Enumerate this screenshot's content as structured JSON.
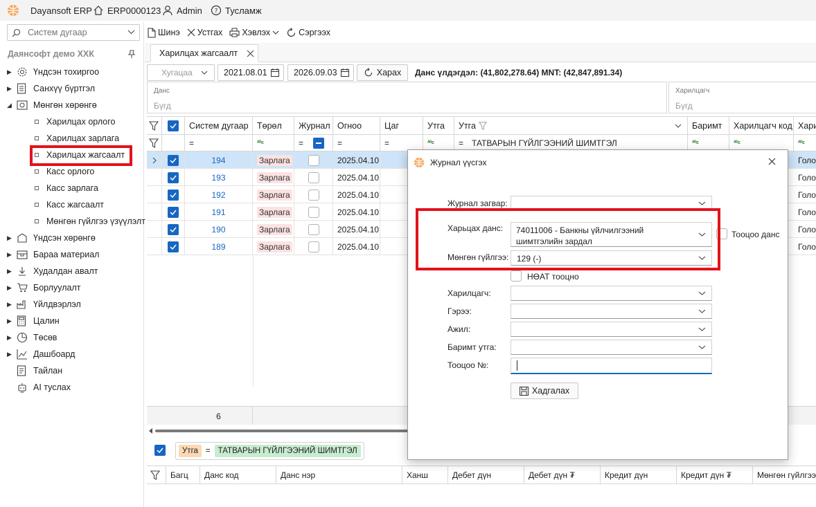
{
  "titlebar": {
    "app_name": "Dayansoft ERP",
    "db_name": "ERP0000123",
    "user": "Admin",
    "help": "Тусламж"
  },
  "sidebar": {
    "search_placeholder": "Систем дугаар",
    "company": "Даянсофт демо ХХК",
    "items": [
      {
        "label": "Үндсэн тохиргоо",
        "icon": "gear-icon"
      },
      {
        "label": "Санхүү бүртгэл",
        "icon": "ledger-icon"
      },
      {
        "label": "Мөнгөн хөрөнгө",
        "icon": "money-icon"
      },
      {
        "label": "Харилцах орлого"
      },
      {
        "label": "Харилцах зарлага"
      },
      {
        "label": "Харилцах жагсаалт"
      },
      {
        "label": "Касс орлого"
      },
      {
        "label": "Касс зарлага"
      },
      {
        "label": "Касс жагсаалт"
      },
      {
        "label": "Мөнгөн гүйлгээ үзүүлэлт"
      },
      {
        "label": "Үндсэн хөрөнгө",
        "icon": "asset-icon"
      },
      {
        "label": "Бараа материал",
        "icon": "inventory-icon"
      },
      {
        "label": "Худалдан авалт",
        "icon": "purchase-icon"
      },
      {
        "label": "Борлуулалт",
        "icon": "cart-icon"
      },
      {
        "label": "Үйлдвэрлэл",
        "icon": "factory-icon"
      },
      {
        "label": "Цалин",
        "icon": "calculator-icon"
      },
      {
        "label": "Төсөв",
        "icon": "pie-icon"
      },
      {
        "label": "Дашбоард",
        "icon": "chart-icon"
      },
      {
        "label": "Тайлан",
        "icon": "report-icon"
      },
      {
        "label": "AI туслах",
        "icon": "robot-icon"
      }
    ]
  },
  "toolbar": {
    "new": "Шинэ",
    "delete": "Устгах",
    "print": "Хэвлэх",
    "refresh": "Сэргээх"
  },
  "tab": {
    "title": "Харилцах жагсаалт"
  },
  "filter": {
    "period_placeholder": "Хугацаа",
    "date_from": "2021.08.01",
    "date_to": "2026.09.03",
    "view_button": "Харах",
    "balance": "Данс үлдэгдэл: (41,802,278.64) MNT: (42,847,891.34)",
    "account_label": "Данс",
    "account_placeholder": "Бүгд",
    "customer_label": "Харилцагч",
    "customer_placeholder": "Бүгд"
  },
  "grid": {
    "headers": [
      "Систем дугаар",
      "Төрөл",
      "Журнал",
      "Огноо",
      "Цаг",
      "Утга",
      "Утга",
      "Баримт",
      "Харилцагч код",
      "Хари"
    ],
    "filter_eq": "=",
    "filter_abc": "ᴬᴮc",
    "filter_text": "ТАТВАРЫН ГҮЙЛГЭЭНИЙ ШИМТГЭЛ",
    "rows": [
      {
        "id": "194",
        "type": "Зарлага",
        "date": "2025.04.10",
        "right": "Голо"
      },
      {
        "id": "193",
        "type": "Зарлага",
        "date": "2025.04.10",
        "right": "Голо"
      },
      {
        "id": "192",
        "type": "Зарлага",
        "date": "2025.04.10",
        "right": "Голо"
      },
      {
        "id": "191",
        "type": "Зарлага",
        "date": "2025.04.10",
        "right": "Голо"
      },
      {
        "id": "190",
        "type": "Зарлага",
        "date": "2025.04.10",
        "right": "Голо"
      },
      {
        "id": "189",
        "type": "Зарлага",
        "date": "2025.04.10",
        "right": "Голо"
      }
    ],
    "footer_count": "6"
  },
  "filter_chip": {
    "field": "Утга",
    "op": "=",
    "value": "ТАТВАРЫН ГҮЙЛГЭЭНИЙ ШИМТГЭЛ"
  },
  "bottom_grid": {
    "headers": [
      "Багц",
      "Данс код",
      "Данс нэр",
      "Ханш",
      "Дебет дүн",
      "Дебет дүн ₮",
      "Кредит дүн",
      "Кредит дүн ₮",
      "Мөнгөн гүйлгээ"
    ]
  },
  "dialog": {
    "title": "Журнал үүсгэх",
    "template_label": "Журнал загвар:",
    "template_value": "",
    "account_label": "Харьцах данс:",
    "account_value_line1": "74011006 - Банкны үйлчилгээний",
    "account_value_line2": "шимтгэлийн зардал",
    "calc_account": "Тооцоо данс",
    "cash_flow_label": "Мөнгөн гүйлгээ:",
    "cash_flow_value": "129 (-)",
    "vat_label": "НӨАТ тооцно",
    "customer_label": "Харилцагч:",
    "contract_label": "Гэрээ:",
    "job_label": "Ажил:",
    "doc_label": "Баримт утга:",
    "calc_no_label": "Тооцоо №:",
    "save_button": "Хадгалах"
  },
  "colors": {
    "accent": "#1767c2",
    "highlight": "#e3121b",
    "selected_row": "#cfe4f8",
    "tag_red": "#fde2e2",
    "chip_green": "#c8ecd0",
    "chip_orange": "#fbd9b4"
  }
}
